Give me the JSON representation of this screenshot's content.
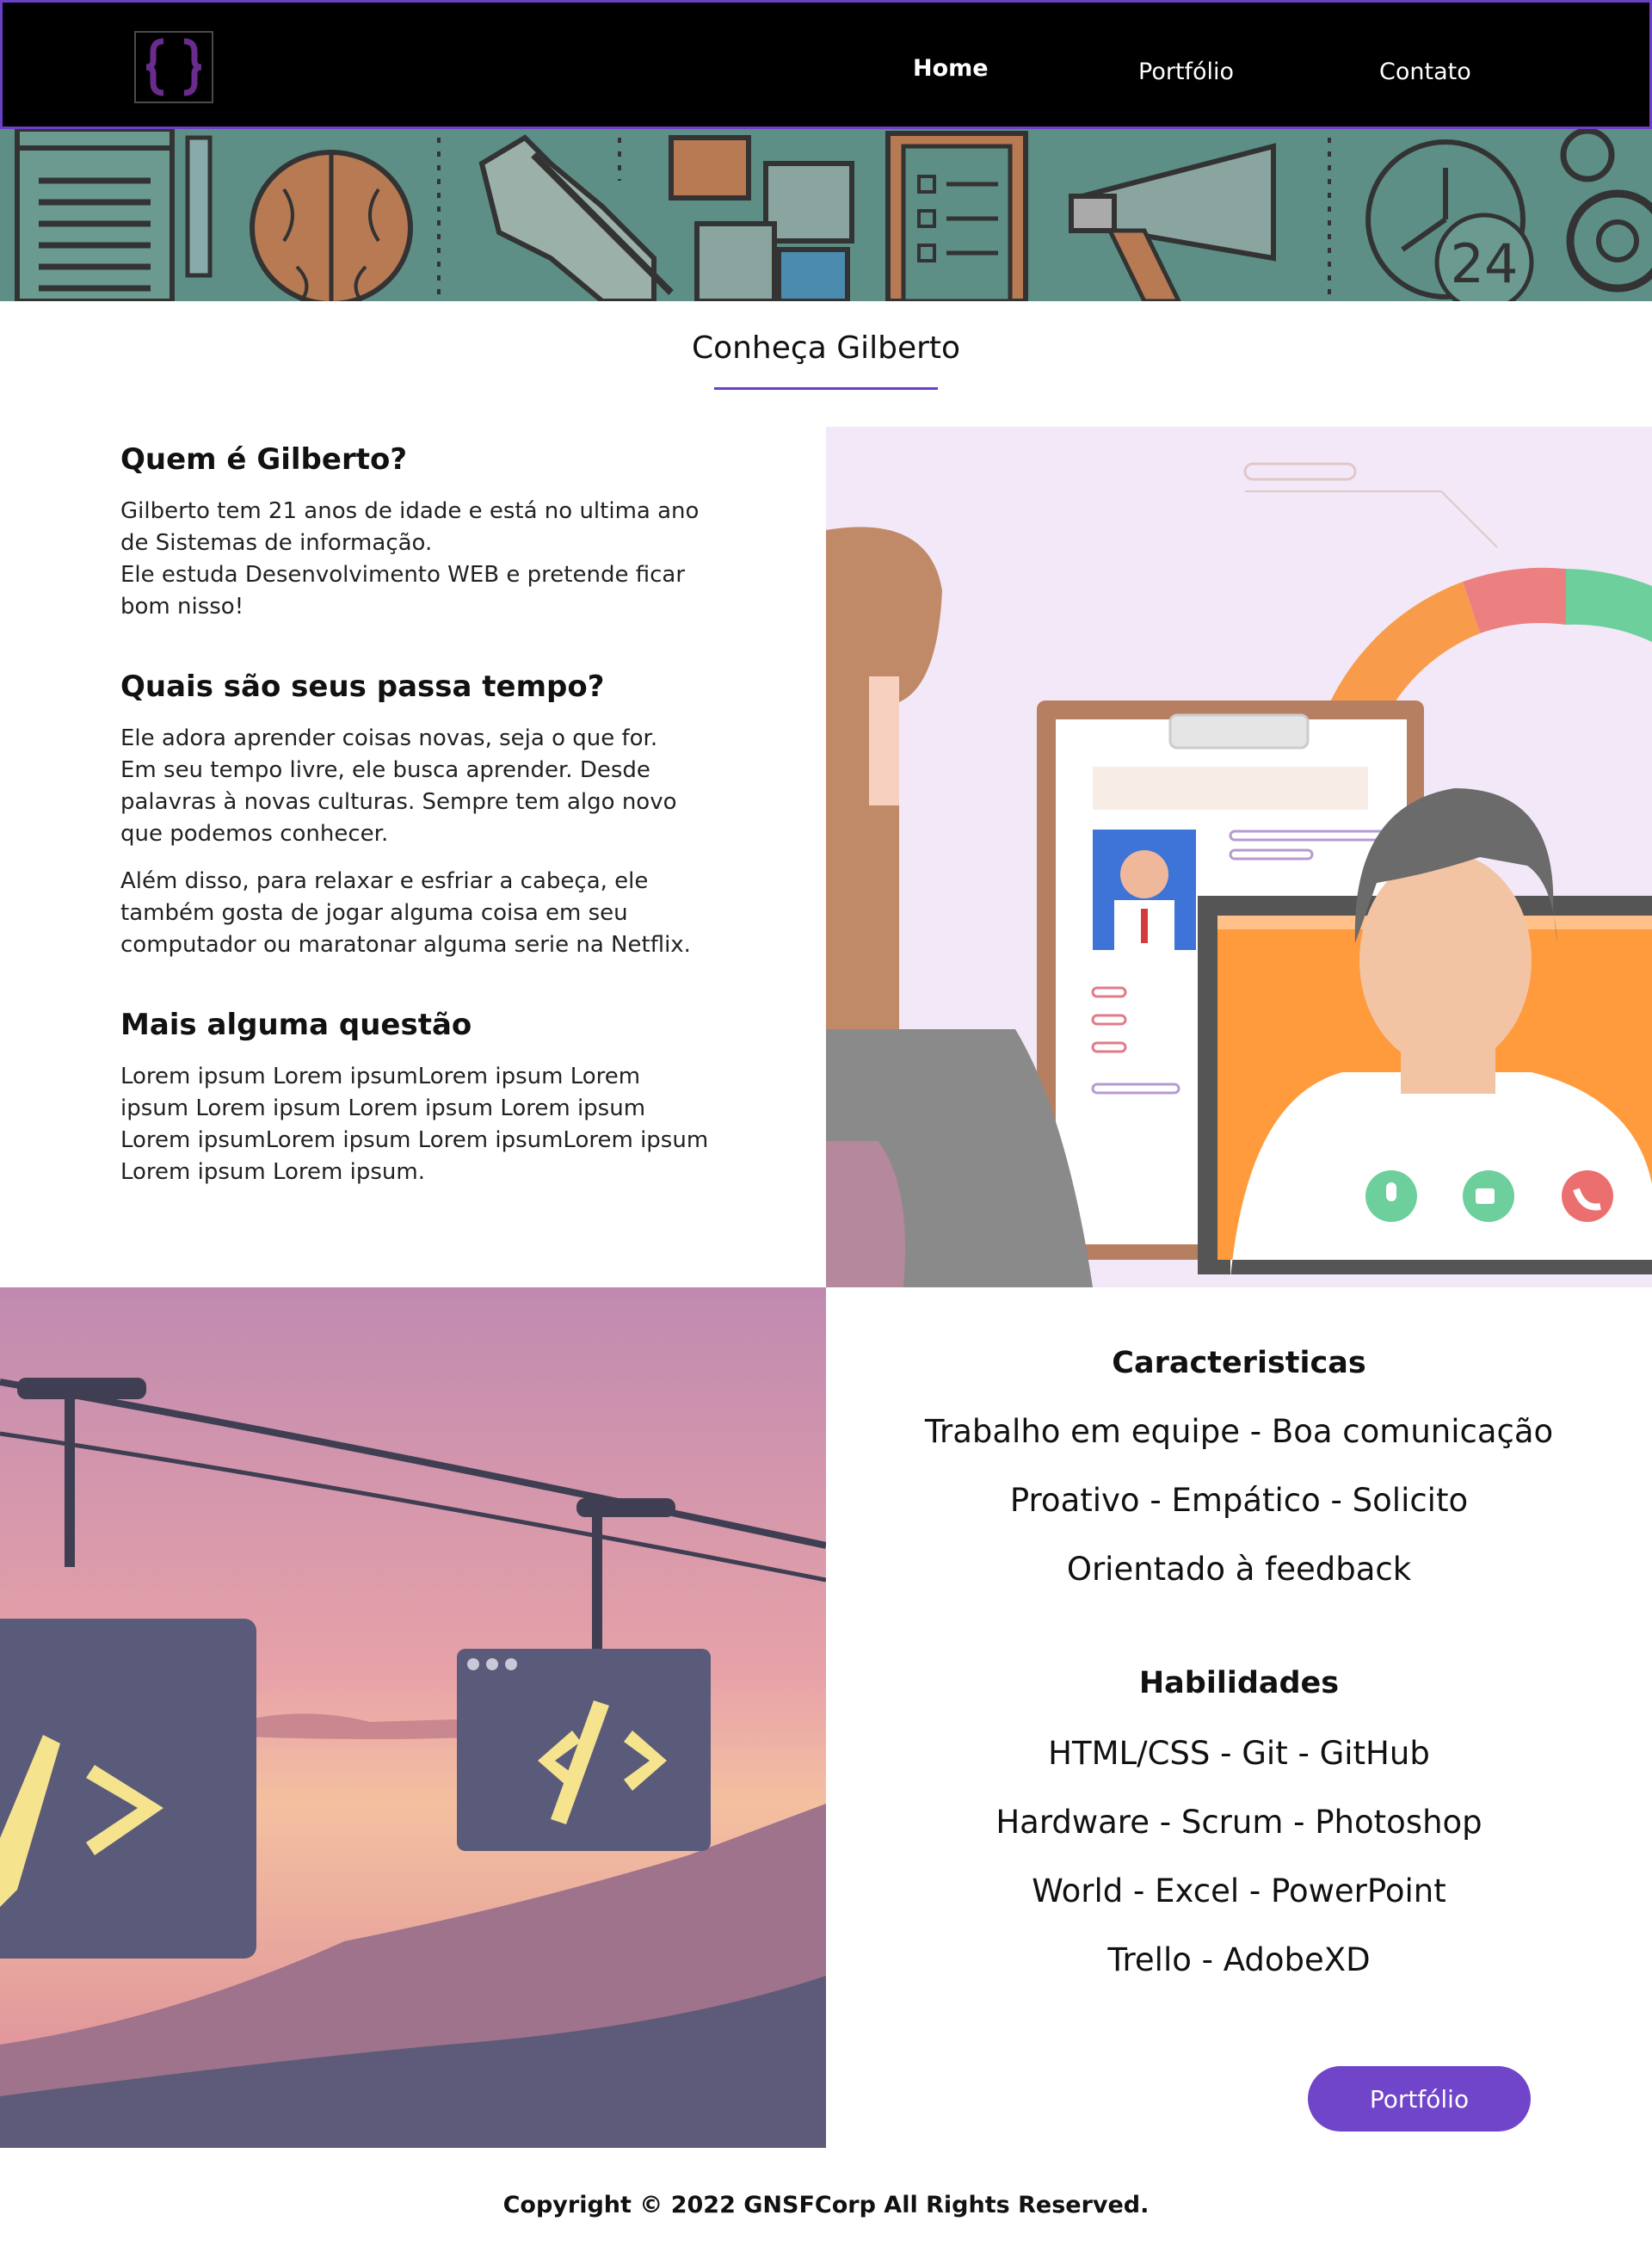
{
  "nav": {
    "logo_icon": "curly-braces-logo",
    "home": "Home",
    "portfolio": "Portfólio",
    "contact": "Contato"
  },
  "section_title": "Conheça Gilberto",
  "about": {
    "q1_title": "Quem é Gilberto?",
    "q1_p1": "Gilberto tem 21 anos de idade e está no ultima ano de Sistemas de informação.",
    "q1_p2": "Ele estuda Desenvolvimento WEB e pretende ficar bom nisso!",
    "q2_title": "Quais são seus passa tempo?",
    "q2_p1": "Ele adora aprender coisas novas, seja o que for.",
    "q2_p2": "Em seu tempo livre, ele busca aprender. Desde palavras à novas culturas. Sempre tem algo novo que podemos conhecer.",
    "q2_p3": "Além disso, para relaxar e esfriar a cabeça, ele também gosta de jogar alguma coisa em seu computador ou maratonar alguma serie na Netflix.",
    "q3_title": "Mais alguma questão",
    "q3_p1": "Lorem ipsum  Lorem ipsumLorem ipsum  Lorem ipsum Lorem ipsum Lorem ipsum Lorem ipsum Lorem ipsumLorem ipsum  Lorem ipsumLorem ipsum Lorem ipsum Lorem ipsum."
  },
  "features": {
    "title": "Caracteristicas",
    "lines": [
      "Trabalho em equipe - Boa comunicação",
      "Proativo - Empático - Solicito",
      "Orientado à feedback"
    ]
  },
  "skills": {
    "title": "Habilidades",
    "lines": [
      "HTML/CSS - Git - GitHub",
      "Hardware - Scrum - Photoshop",
      "World - Excel - PowerPoint",
      "Trello - AdobeXD"
    ]
  },
  "portfolio_button": "Portfólio",
  "footer": "Copyright © 2022 GNSFCorp All Rights Reserved.",
  "colors": {
    "accent": "#7045c9",
    "nav_bg": "#000000",
    "banner_bg": "#5d8f86"
  }
}
